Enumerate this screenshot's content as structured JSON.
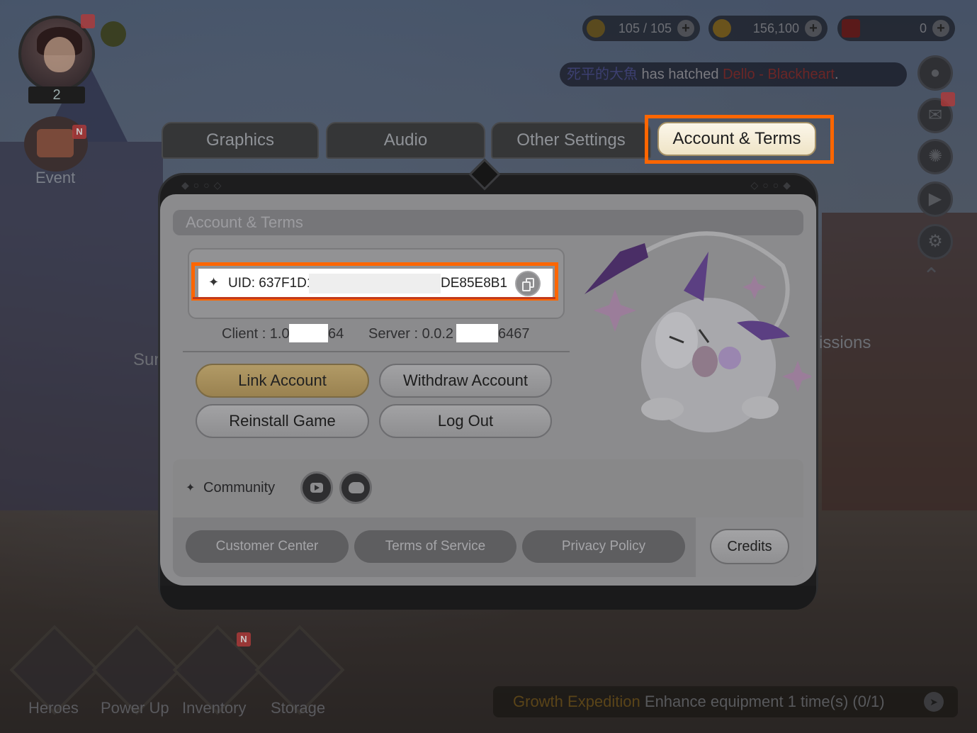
{
  "hud": {
    "level": "2",
    "event_label": "Event",
    "keys": "105  /  105",
    "gold": "156,100",
    "gems": "0",
    "ticker_name": "死平的大魚",
    "ticker_mid": " has hatched ",
    "ticker_hero": "Dello - Blackheart",
    "ticker_end": ".",
    "bg_left_text": "Sur",
    "bg_right_text": "issions",
    "badge_n": "N"
  },
  "bottom_nav": [
    {
      "label": "Heroes"
    },
    {
      "label": "Power Up"
    },
    {
      "label": "Inventory"
    },
    {
      "label": "Storage"
    }
  ],
  "mission": {
    "tag": "Growth Expedition",
    "text": "Enhance equipment 1 time(s) (0/1)"
  },
  "tabs": {
    "graphics": "Graphics",
    "audio": "Audio",
    "other": "Other Settings",
    "account": "Account & Terms"
  },
  "panel": {
    "title": "Account & Terms",
    "uid_prefix": "UID: 637F1D1",
    "uid_suffix": "DE85E8B1",
    "client_prefix": "Client : 1.0",
    "client_suffix": "64",
    "server_prefix": "Server : 0.0.2",
    "server_suffix": "6467",
    "buttons": {
      "link": "Link Account",
      "withdraw": "Withdraw Account",
      "reinstall": "Reinstall Game",
      "logout": "Log Out"
    },
    "community_label": "Community",
    "links": {
      "customer": "Customer Center",
      "tos": "Terms of Service",
      "privacy": "Privacy Policy",
      "credits": "Credits"
    }
  },
  "icons": {
    "youtube": "youtube-icon",
    "discord": "discord-icon",
    "copy": "copy-icon"
  },
  "colors": {
    "highlight": "#ff6600",
    "active_tab_bg": "#f6efd9",
    "gold_button": "#a88f5b"
  }
}
